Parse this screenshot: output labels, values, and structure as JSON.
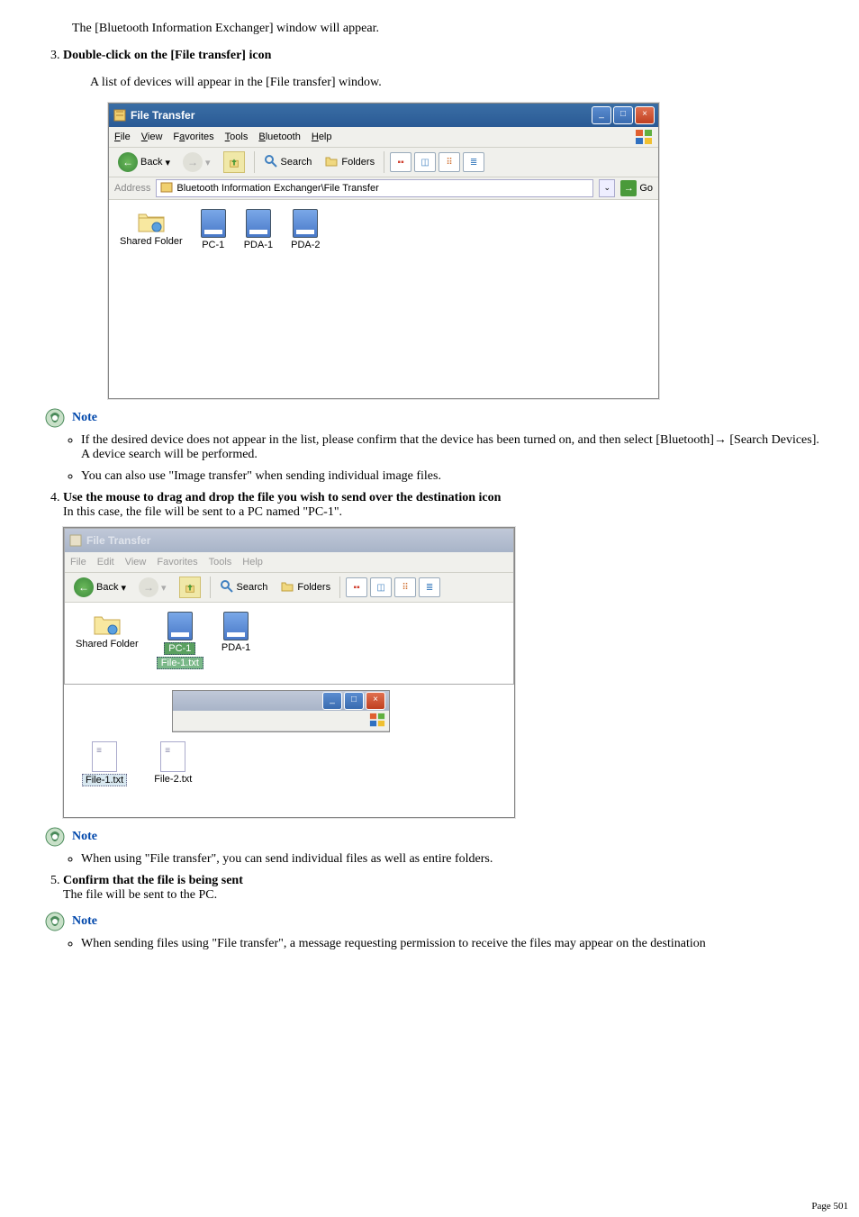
{
  "doc": {
    "line_top": "The [Bluetooth Information Exchanger] window will appear.",
    "step3_heading": "Double-click on the [File transfer] icon",
    "step3_desc": "A list of devices will appear in the [File transfer] window.",
    "note_label": "Note",
    "note3_a": "If the desired device does not appear in the list, please confirm that the device has been turned on, and then select [Bluetooth]→ [Search Devices].",
    "note3_a2": "A device search will be performed.",
    "note3_b": "You can also use \"Image transfer\" when sending individual image files.",
    "step4_heading": "Use the mouse to drag and drop the file you wish to send over the destination icon",
    "step4_desc": "In this case, the file will be sent to a PC named \"PC-1\".",
    "note4_a": "When using \"File transfer\", you can send individual files as well as entire folders.",
    "step5_heading": "Confirm that the file is being sent",
    "step5_desc": "The file will be sent to the PC.",
    "note5_a": "When sending files using \"File transfer\", a message requesting permission to receive the files may appear on the destination",
    "page_number": "Page 501"
  },
  "win1": {
    "title": "File Transfer",
    "menu": {
      "file": "File",
      "view": "View",
      "favorites": "Favorites",
      "tools": "Tools",
      "bluetooth": "Bluetooth",
      "help": "Help"
    },
    "toolbar": {
      "back": "Back",
      "search": "Search",
      "folders": "Folders"
    },
    "addr_label": "Address",
    "addr_value": "Bluetooth Information Exchanger\\File Transfer",
    "go": "Go",
    "items": {
      "shared": "Shared Folder",
      "pc1": "PC-1",
      "pda1": "PDA-1",
      "pda2": "PDA-2"
    }
  },
  "win2": {
    "title": "File Transfer",
    "menu": {
      "file": "File",
      "edit": "Edit",
      "view": "View",
      "favorites": "Favorites",
      "tools": "Tools",
      "help": "Help"
    },
    "toolbar": {
      "back": "Back",
      "search": "Search",
      "folders": "Folders"
    },
    "items": {
      "shared": "Shared Folder",
      "pc1": "PC-1",
      "pda1": "PDA-1"
    },
    "drag_item": "File-1.txt",
    "sub_items": {
      "f1": "File-1.txt",
      "f2": "File-2.txt"
    }
  }
}
